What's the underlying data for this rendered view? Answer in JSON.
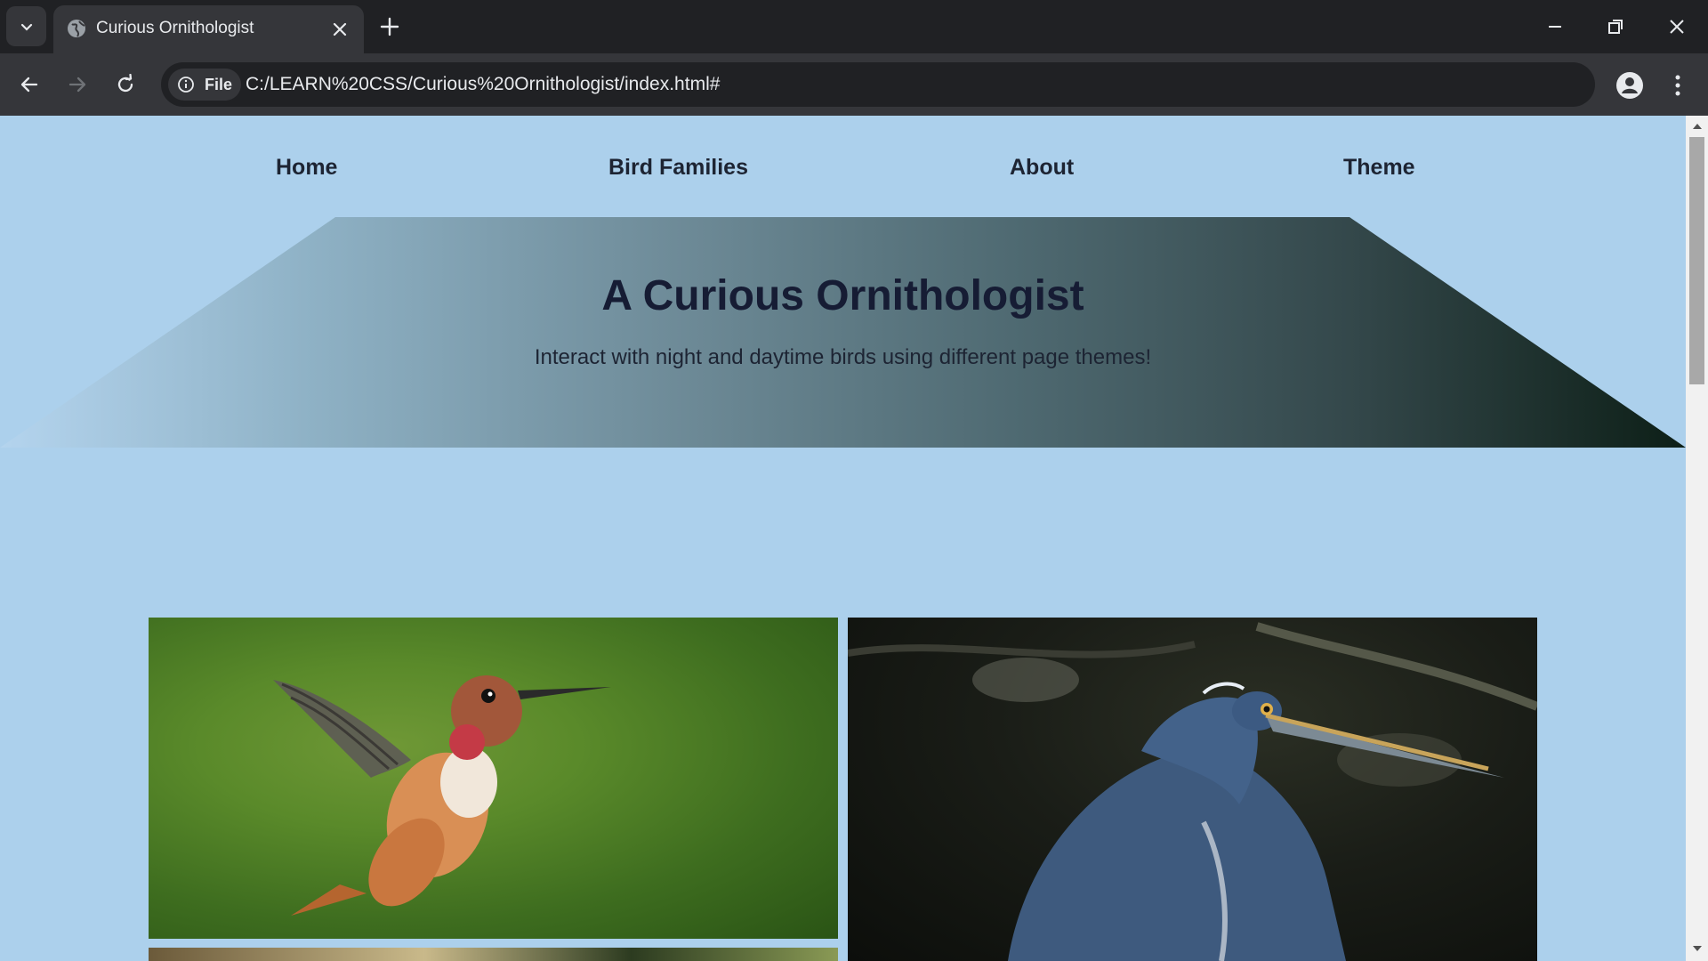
{
  "browser": {
    "tab_title": "Curious Ornithologist",
    "site_chip_label": "File",
    "url": "C:/LEARN%20CSS/Curious%20Ornithologist/index.html#"
  },
  "site": {
    "nav": [
      {
        "label": "Home"
      },
      {
        "label": "Bird Families"
      },
      {
        "label": "About"
      },
      {
        "label": "Theme"
      }
    ],
    "hero": {
      "title": "A Curious Ornithologist",
      "subtitle": "Interact with night and daytime birds using different page themes!"
    }
  }
}
